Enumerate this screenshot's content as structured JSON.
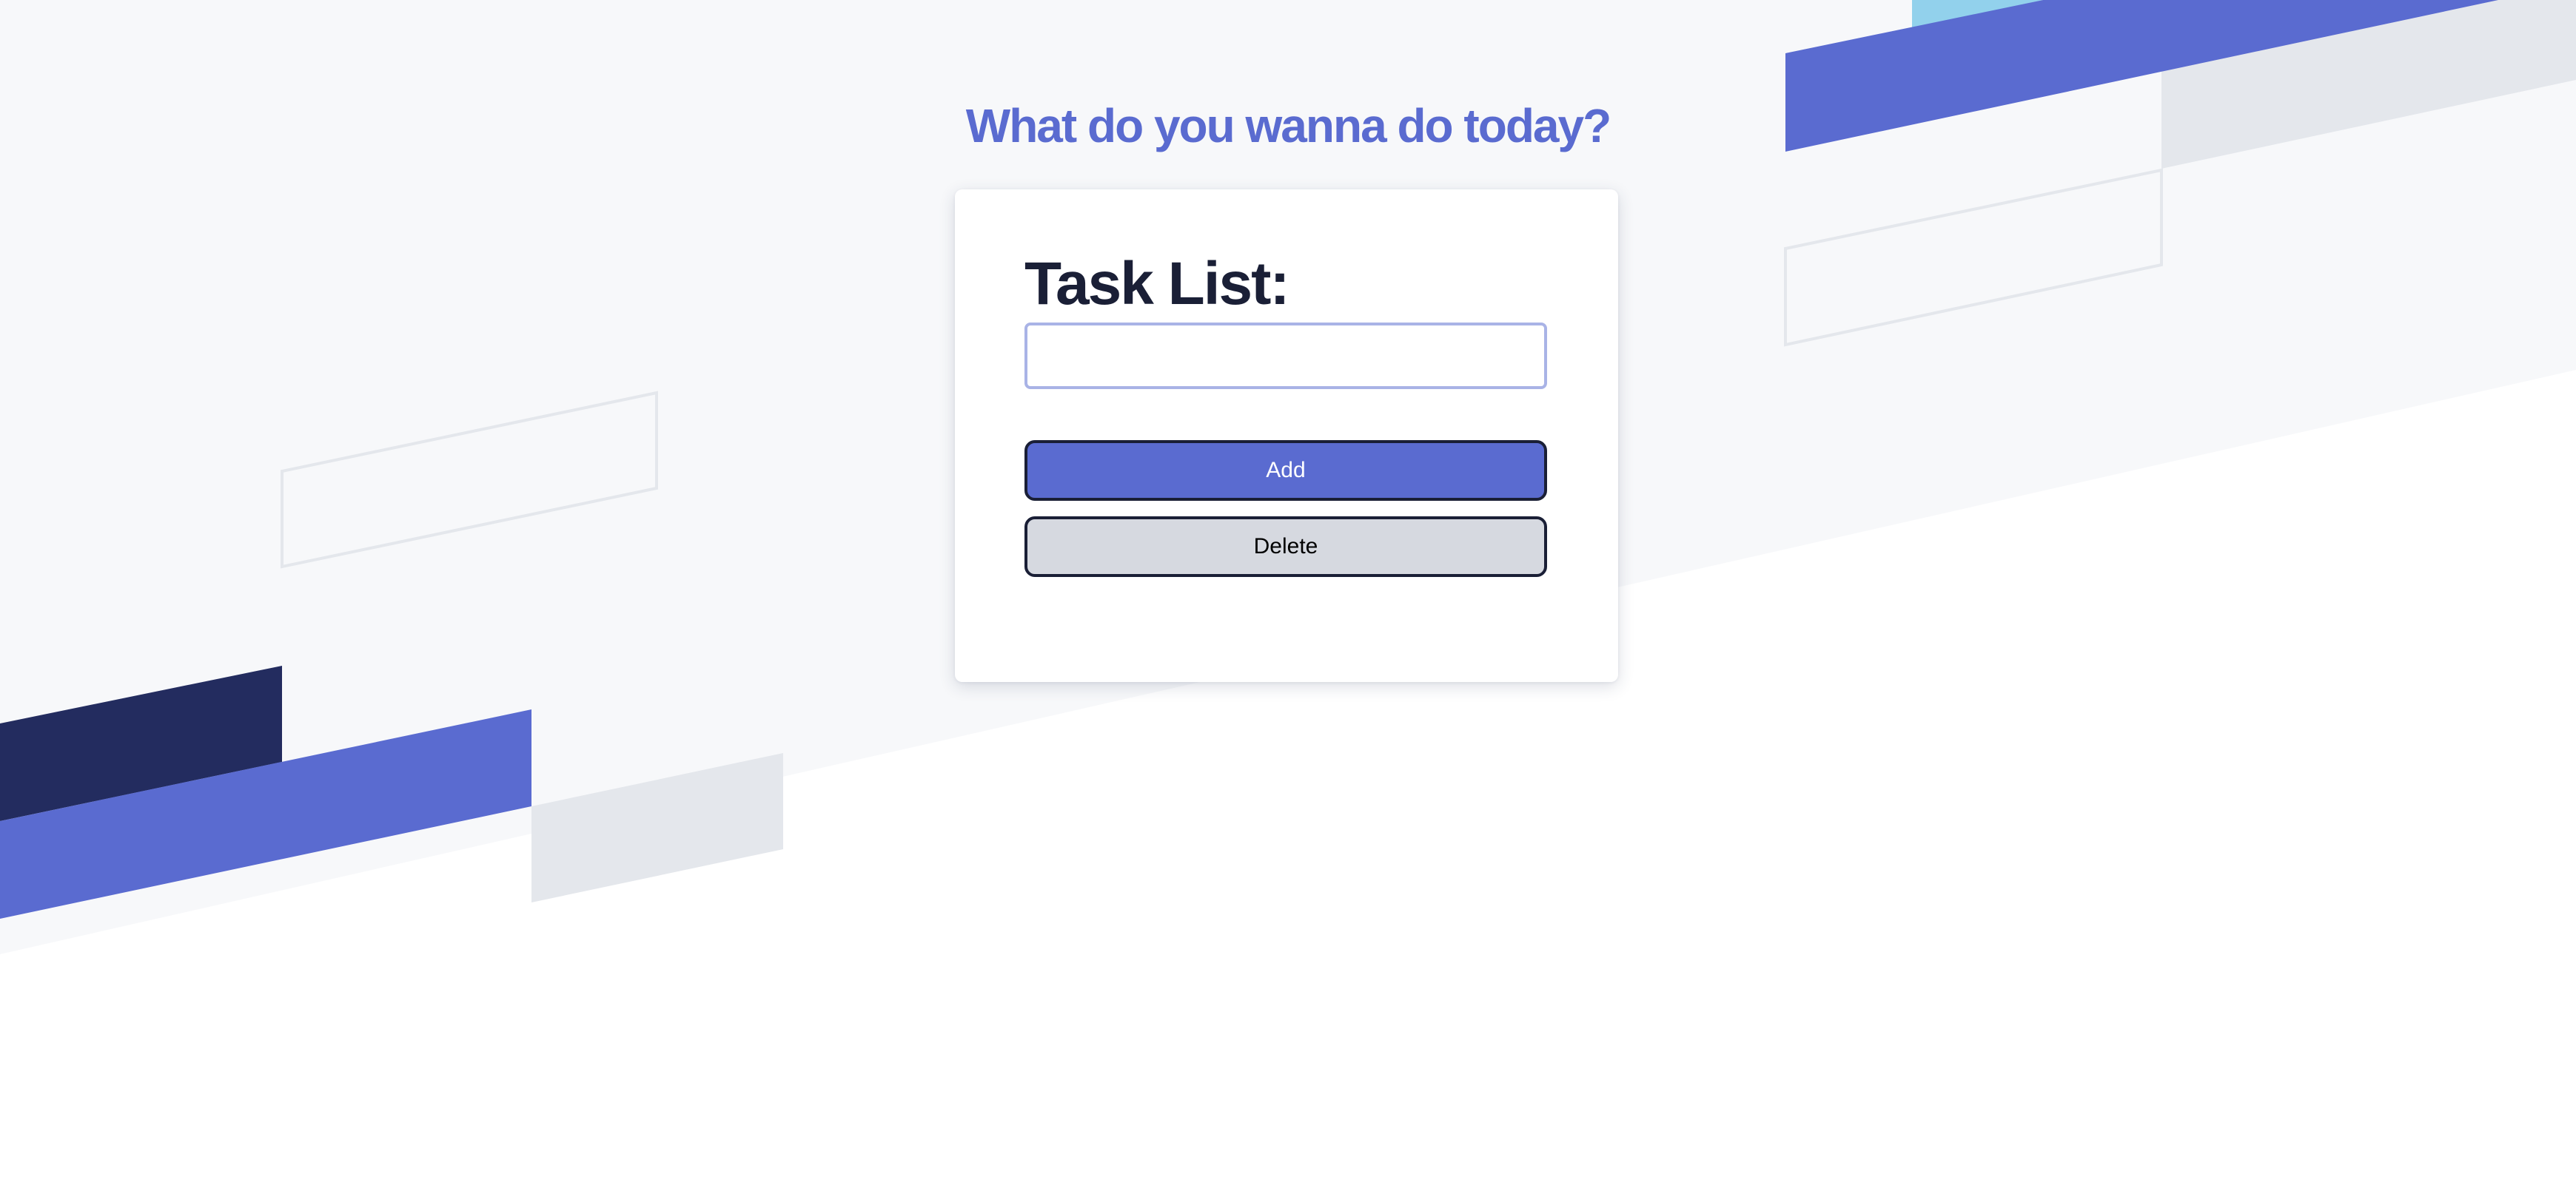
{
  "page": {
    "headline": "What do you wanna do today?"
  },
  "card": {
    "title": "Task List:",
    "task_input": {
      "value": "",
      "placeholder": ""
    },
    "add_label": "Add",
    "delete_label": "Delete"
  },
  "colors": {
    "accent": "#5a6bd0",
    "navy": "#232c5f",
    "light_blue": "#92d1ec",
    "gray_band": "#e4e7ec",
    "background_tint": "#f7f8fa",
    "title_text": "#1a1f36"
  }
}
